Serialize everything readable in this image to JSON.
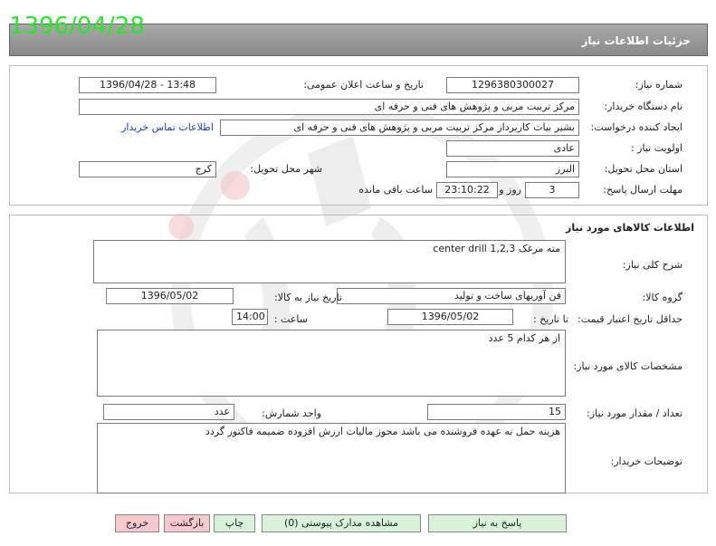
{
  "stamp_date": "1396/04/28",
  "header": {
    "title": "جزئیات اطلاعات نیاز"
  },
  "info": {
    "need_number_label": "شماره نیاز:",
    "need_number": "1296380300027",
    "announce_label": "تاریخ و ساعت اعلان عمومی:",
    "announce_value": "1396/04/28 - 13:48",
    "buyer_org_label": "نام دستگاه خریدار:",
    "buyer_org": "مرکز تربیت مربی و پژوهش های فنی و حرفه ای",
    "requester_label": "ایجاد کننده درخواست:",
    "requester": "بشیر بیات کاربرداز مرکز تربیت مربی و پژوهش های فنی و حرفه ای",
    "contact_link": "اطلاعات تماس خریدار",
    "priority_label": "اولویت نیاز :",
    "priority": "عادی",
    "province_label": "استان محل تحویل:",
    "province": "البرز",
    "city_label": "شهر محل تحویل:",
    "city": "کرج",
    "deadline_label": "مهلت ارسال پاسخ:",
    "days": "3",
    "days_word": "روز و",
    "time_remaining": "23:10:22",
    "remaining_word": "ساعت باقی مانده"
  },
  "goods": {
    "section_title": "اطلاعات کالاهای مورد نیاز",
    "summary_label": "شرح کلی نیاز:",
    "summary": "مته مرغک center drill 1,2,3",
    "group_label": "گروه کالا:",
    "group": "فن آوریهای ساخت و تولید",
    "need_date_label": "تاریخ نیاز به کالا:",
    "need_date": "1396/05/02",
    "validity_label": "حداقل تاریخ اعتبار قیمت:",
    "to_date_label": "تا تاریخ :",
    "validity_date": "1396/05/02",
    "time_label": "ساعت :",
    "validity_time": "14:00",
    "spec_label": "مشخصات کالای مورد نیاز:",
    "spec": "از هر کدام 5 عدد",
    "qty_label": "تعداد / مقدار مورد نیاز:",
    "qty": "15",
    "unit_label": "واحد شمارش:",
    "unit": "عدد",
    "buyer_notes_label": "توضیحات خریدار:",
    "buyer_notes": "هزینه حمل به عهده فروشنده می باشد مجوز مالیات ارزش افزوده ضمیمه فاکتور گردد"
  },
  "buttons": {
    "reply": "پاسخ به نیاز",
    "attachments": "مشاهده مدارک پیوستی (0)",
    "print": "چاپ",
    "back": "بازگشت",
    "exit": "خروج"
  },
  "colors": {
    "stamp_green": "#27e827",
    "header_gray": "#9a9a9a",
    "link_blue": "#1b3fb8"
  }
}
